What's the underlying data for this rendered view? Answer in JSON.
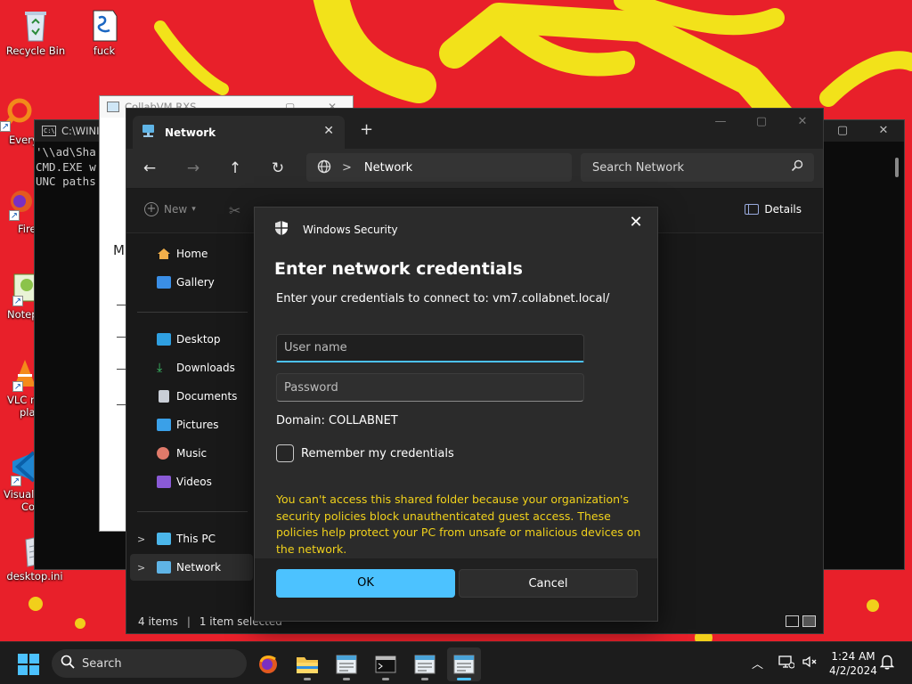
{
  "desktop": {
    "icons": [
      {
        "label": "Recycle Bin"
      },
      {
        "label": "fuck"
      },
      {
        "label": "Every"
      },
      {
        "label": "Fire"
      },
      {
        "label": "Notep"
      },
      {
        "label": "VLC m"
      },
      {
        "label": "pla"
      },
      {
        "label": "Visual"
      },
      {
        "label": "Co"
      },
      {
        "label": "desktop.ini"
      }
    ]
  },
  "cmd_window": {
    "title": "C:\\WINI",
    "lines": [
      "'\\\\ad\\Sha",
      "CMD.EXE w",
      "UNC paths"
    ]
  },
  "collab_window": {
    "title": "CollabVM.RXS",
    "fragment": "M"
  },
  "explorer": {
    "tab_label": "Network",
    "address": "Network",
    "search_placeholder": "Search Network",
    "toolbar": {
      "new_label": "New",
      "details_label": "Details"
    },
    "nav_items": [
      {
        "label": "Home"
      },
      {
        "label": "Gallery"
      },
      {
        "label": "Desktop"
      },
      {
        "label": "Downloads"
      },
      {
        "label": "Documents"
      },
      {
        "label": "Pictures"
      },
      {
        "label": "Music"
      },
      {
        "label": "Videos"
      },
      {
        "label": "This PC"
      },
      {
        "label": "Network"
      }
    ],
    "status": {
      "items": "4 items",
      "selected": "1 item selected"
    }
  },
  "dialog": {
    "app_name": "Windows Security",
    "title": "Enter network credentials",
    "prompt": "Enter your credentials to connect to: vm7.collabnet.local/",
    "username_placeholder": "User name",
    "password_placeholder": "Password",
    "domain": "Domain: COLLABNET",
    "remember_label": "Remember my credentials",
    "warning": "You can't access this shared folder because your organization's security policies block unauthenticated guest access. These policies help protect your PC from unsafe or malicious devices on the network.",
    "ok_label": "OK",
    "cancel_label": "Cancel",
    "colors": {
      "accent": "#4cc2ff",
      "warning": "#f0d11c"
    }
  },
  "taskbar": {
    "search_label": "Search",
    "apps": [
      "firefox-icon",
      "file-explorer-icon",
      "notepad-icon",
      "terminal-icon",
      "notepad-icon",
      "notepad-icon"
    ],
    "clock": {
      "time": "1:24 AM",
      "date": "4/2/2024"
    }
  }
}
